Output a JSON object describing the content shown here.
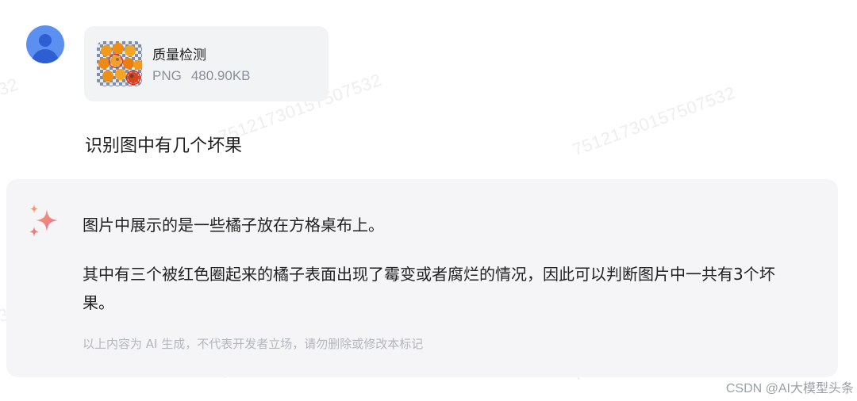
{
  "user": {
    "avatar_icon": "user-avatar-icon",
    "attachment": {
      "name": "质量检测",
      "type": "PNG",
      "size": "480.90KB",
      "thumbnail_icon": "oranges-photo"
    },
    "question": "识别图中有几个坏果"
  },
  "ai": {
    "icon": "ai-sparkle-icon",
    "paragraph1": "图片中展示的是一些橘子放在方格桌布上。",
    "paragraph2": "其中有三个被红色圈起来的橘子表面出现了霉变或者腐烂的情况，因此可以判断图片中一共有3个坏果。",
    "disclaimer": "以上内容为 AI 生成，不代表开发者立场，请勿删除或修改本标记"
  },
  "watermark": {
    "text": "75121730157507532"
  },
  "footer": {
    "credit": "CSDN @AI大模型头条"
  },
  "colors": {
    "avatar": "#5b8ff0",
    "card_bg": "#f2f3f5",
    "ai_card_bg": "#f5f5f7",
    "sparkle_a": "#f49a6c",
    "sparkle_b": "#e86fa6"
  }
}
